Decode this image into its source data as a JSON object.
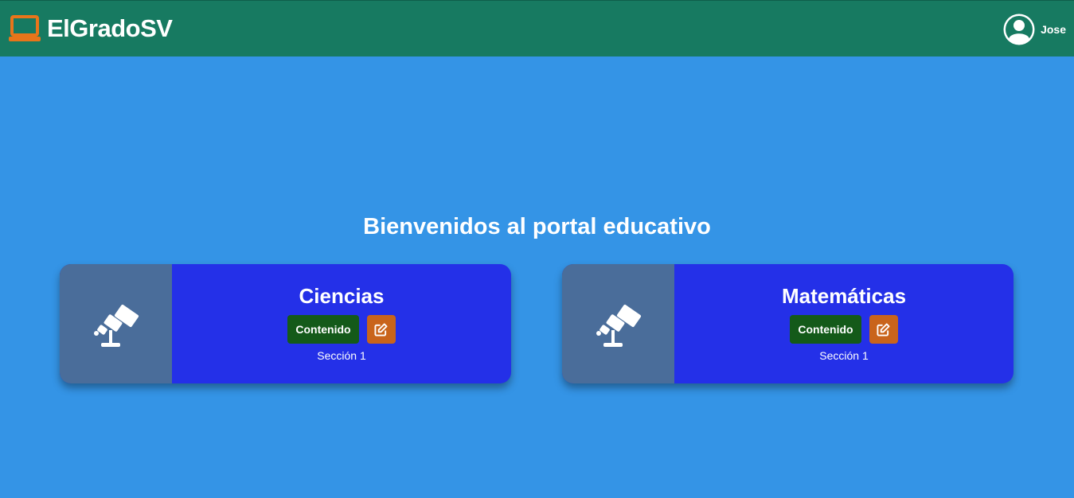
{
  "navbar": {
    "brand": "ElGradoSV",
    "brand_icon": "laptop-icon",
    "brand_icon_color": "#e8751a",
    "user_name": "Jose",
    "user_icon": "user-avatar-icon"
  },
  "main": {
    "welcome": "Bienvenidos al portal educativo",
    "courses": [
      {
        "title": "Ciencias",
        "icon": "telescope-icon",
        "content_button": "Contenido",
        "edit_icon": "edit-icon",
        "section": "Sección 1"
      },
      {
        "title": "Matemáticas",
        "icon": "telescope-icon",
        "content_button": "Contenido",
        "edit_icon": "edit-icon",
        "section": "Sección 1"
      }
    ]
  },
  "colors": {
    "background": "#3494e6",
    "navbar": "#177a61",
    "card": "#2430e8",
    "card_media": "#4a6d9a",
    "content_button": "#145a19",
    "edit_button": "#c9641b"
  }
}
